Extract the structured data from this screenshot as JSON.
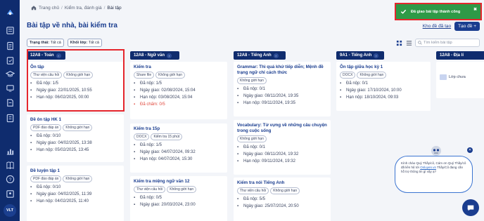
{
  "breadcrumb": [
    "Trang chủ",
    "Kiểm tra, đánh giá",
    "Bài tập"
  ],
  "page_title": "Bài tập về nhà, bài kiểm tra",
  "header": {
    "trash_label": "Kho đề đã tạo",
    "create_label": "Tạo đề"
  },
  "filters": {
    "status_label": "Trạng thái:",
    "status_value": "Tất cả",
    "grade_label": "Khối lớp:",
    "grade_value": "Tất cả"
  },
  "search": {
    "placeholder": "Tìm kiếm bài tập"
  },
  "toast": {
    "message": "Đã giao bài tập thành công"
  },
  "columns": [
    {
      "header": "12A8 - Toán",
      "cards": [
        {
          "title": "Ôn tập",
          "tags": [
            "Thư viện câu hỏi",
            "Không giới hạn"
          ],
          "submitted": "Đã nộp: 1/5",
          "assigned": "Ngày giao: 22/01/2025, 10:55",
          "deadline": "Hạn nộp: 06/02/2025, 00:00"
        },
        {
          "title": "Đề ôn tập HK 1",
          "tags": [
            "PDF đáo đáp án",
            "Không giới hạn"
          ],
          "submitted": "Đã nộp: 0/10",
          "assigned": "Ngày giao: 04/02/2025, 13:38",
          "deadline": "Hạn nộp: 05/02/2025, 13:45"
        },
        {
          "title": "Đề luyện tập 1",
          "tags": [
            "PDF đáo đáp án",
            "Không giới hạn"
          ],
          "submitted": "Đã nộp: 0/10",
          "assigned": "Ngày giao: 04/02/2025, 11:39",
          "deadline": "Hạn nộp: 04/02/2025, 11:40"
        }
      ]
    },
    {
      "header": "12A8 - Ngữ văn",
      "cards": [
        {
          "title": "Kiểm tra",
          "tags": [
            "Share file",
            "Không giới hạn"
          ],
          "submitted": "Đã nộp: 1/5",
          "assigned": "Ngày giao: 02/08/2024, 15:04",
          "deadline": "Hạn nộp: 03/08/2024, 15:04",
          "extra": "Đã chấm: 0/5"
        },
        {
          "title": "Kiểm tra 15p",
          "tags": [
            "DOCX",
            "Kiểm tra 15 phút"
          ],
          "submitted": "Đã nộp: 1/5",
          "assigned": "Ngày giao: 04/07/2024, 09:32",
          "deadline": "Hạn nộp: 04/07/2024, 15:30"
        },
        {
          "title": "Kiểm tra miệng ngữ văn 12",
          "tags": [
            "Thư viện câu hỏi",
            "Không giới hạn"
          ],
          "submitted": "Đã nộp: 0/5",
          "assigned": "Ngày giao: 20/03/2024, 23:00"
        }
      ]
    },
    {
      "header": "12A8 - Tiếng Anh",
      "cards": [
        {
          "title": "Grammar: Thì quá khứ tiếp diễn; Mệnh đề trạng ngữ chỉ cách thức",
          "tags": [
            "Không giới hạn"
          ],
          "submitted": "Đã nộp: 0/1",
          "assigned": "Ngày giao: 08/11/2024, 19:35",
          "deadline": "Hạn nộp: 09/11/2024, 19:35"
        },
        {
          "title": "Vocabulary: Từ vựng về những câu chuyện trong cuộc sống",
          "tags": [
            "Không giới hạn"
          ],
          "submitted": "Đã nộp: 0/1",
          "assigned": "Ngày giao: 08/11/2024, 19:32",
          "deadline": "Hạn nộp: 09/11/2024, 19:32"
        },
        {
          "title": "Kiểm tra nói Tiếng Anh",
          "tags": [
            "Thư viện câu hỏi",
            "Không giới hạn"
          ],
          "submitted": "Đã nộp: 5/5",
          "assigned": "Ngày giao: 25/07/2024, 20:50"
        }
      ]
    },
    {
      "header": "9A1 - Tiếng Anh",
      "cards": [
        {
          "title": "Ôn tập giữa học kỳ 1",
          "tags": [
            "DOCX",
            "Không giới hạn"
          ],
          "submitted": "Đã nộp: 0/1",
          "assigned": "Ngày giao: 17/10/2024, 10:00",
          "deadline": "Hạn nộp: 18/10/2024, 09:03"
        }
      ]
    },
    {
      "header": "12A8 - Địa lí",
      "cards": [
        {
          "title": "Lớp chưa"
        }
      ]
    }
  ],
  "chat": {
    "line1": "Kính chào Quý Thầy/cô, Cám ơn Quý Thầy/cô đã liên hệ tới",
    "link": "Onluyen.vn",
    "line2": "Thầy/Cô đang cần hỗ trợ thông tin gì vậy ạ?"
  },
  "user": {
    "initials": "VLT"
  },
  "colors": {
    "sidebar": "#0f2c6e",
    "accent": "#1a3d8f",
    "success": "#2e9a47",
    "highlight": "#e5262d",
    "warning": "#e0483c"
  }
}
